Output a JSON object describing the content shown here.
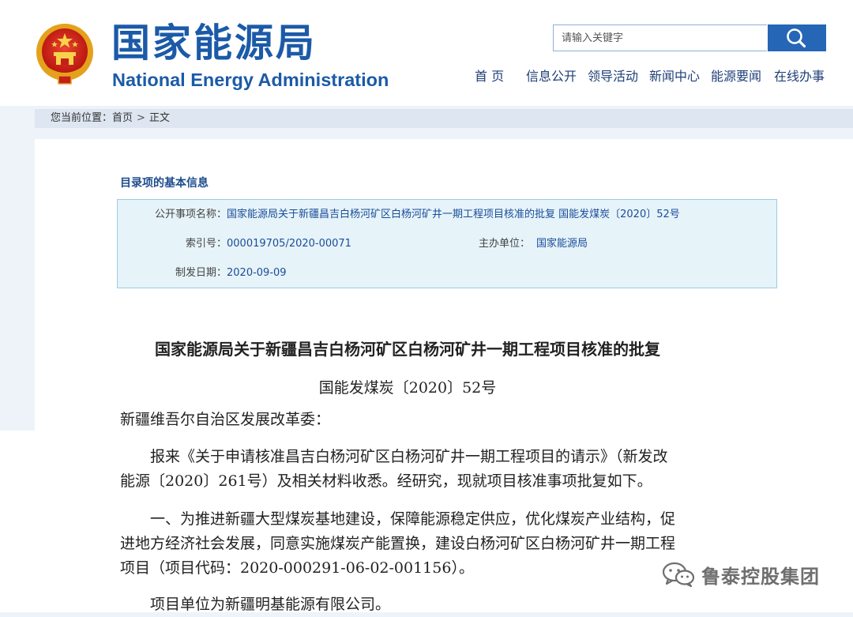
{
  "header": {
    "logo_cn": "国家能源局",
    "logo_en": "National Energy Administration",
    "search_placeholder": "请输入关键字",
    "nav": [
      "首 页",
      "信息公开",
      "领导活动",
      "新闻中心",
      "能源要闻",
      "在线办事"
    ]
  },
  "breadcrumb": {
    "prefix": "您当前位置：",
    "home": "首页",
    "separator": ">",
    "current": "正文"
  },
  "info": {
    "section_title": "目录项的基本信息",
    "name_label": "公开事项名称：",
    "name_value": "国家能源局关于新疆昌吉白杨河矿区白杨河矿井一期工程项目核准的批复  国能发煤炭〔2020〕52号",
    "index_label": "索引号：",
    "index_value": "000019705/2020-00071",
    "org_label": "主办单位：",
    "org_value": "国家能源局",
    "date_label": "制发日期：",
    "date_value": "2020-09-09"
  },
  "document": {
    "title": "国家能源局关于新疆昌吉白杨河矿区白杨河矿井一期工程项目核准的批复",
    "number": "国能发煤炭〔2020〕52号",
    "recipient": "新疆维吾尔自治区发展改革委：",
    "para1": [
      "　　报来《关于申请核准昌吉白杨河矿区白杨河矿井一期工程项目的请示》（新发改",
      "能源〔2020〕261号）及相关材料收悉。经研究，现就项目核准事项批复如下。"
    ],
    "para2": [
      "　　一、为推进新疆大型煤炭基地建设，保障能源稳定供应，优化煤炭产业结构，促",
      "进地方经济社会发展，同意实施煤炭产能置换，建设白杨河矿区白杨河矿井一期工程",
      "项目（项目代码：2020-000291-06-02-001156）。"
    ],
    "para3": "　　项目单位为新疆明基能源有限公司。"
  },
  "watermark": {
    "text": "鲁泰控股集团"
  },
  "colors": {
    "brand_blue": "#1b5aa8",
    "nav_text": "#1f3f77",
    "search_button": "#2566b6",
    "info_bg": "#e6f3f8",
    "link_blue": "#1a4d9b"
  }
}
